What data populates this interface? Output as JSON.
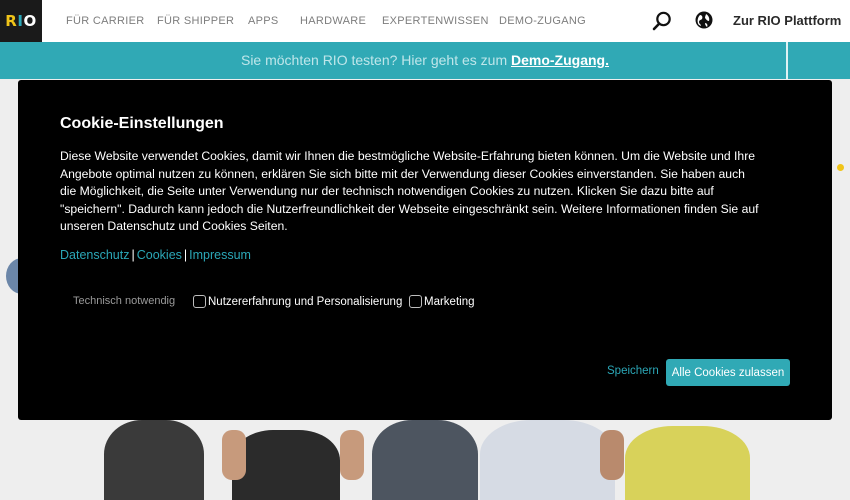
{
  "logo": {
    "text_r": "R",
    "text_i": "I",
    "text_o": "O"
  },
  "nav": {
    "items": [
      {
        "label": "FÜR CARRIER"
      },
      {
        "label": "FÜR SHIPPER"
      },
      {
        "label": "APPS"
      },
      {
        "label": "HARDWARE"
      },
      {
        "label": "EXPERTENWISSEN"
      },
      {
        "label": "DEMO-ZUGANG"
      }
    ],
    "search_icon": "search-icon",
    "globe_icon": "globe-icon",
    "platform_link": "Zur RIO Plattform"
  },
  "banner": {
    "text": "Sie möchten RIO testen? Hier geht es zum",
    "link": "Demo-Zugang."
  },
  "cookie_modal": {
    "title": "Cookie-Einstellungen",
    "text": "Diese Website verwendet Cookies, damit wir Ihnen die bestmögliche Website-Erfahrung bieten können. Um die Website und Ihre Angebote optimal nutzen zu können, erklären Sie sich bitte mit der Verwendung dieser Cookies einverstanden. Sie haben auch die Möglichkeit, die Seite unter Verwendung nur der technisch notwendigen Cookies zu nutzen. Klicken Sie dazu bitte auf \"speichern\". Dadurch kann jedoch die Nutzerfreundlichkeit der Webseite eingeschränkt sein. Weitere Informationen finden Sie auf unseren Datenschutz und Cookies Seiten.",
    "links": {
      "datenschutz": "Datenschutz",
      "cookies": "Cookies",
      "impressum": "Impressum",
      "separator": "|"
    },
    "options": {
      "required": "Technisch notwendig",
      "personalization": "Nutzererfahrung und Personalisierung",
      "marketing": "Marketing"
    },
    "save_label": "Speichern",
    "accept_all_label": "Alle Cookies zulassen"
  },
  "colors": {
    "accent": "#30a9b5",
    "link": "#2ba7b7",
    "logo_yellow": "#f0c419",
    "modal_bg": "#000000"
  }
}
